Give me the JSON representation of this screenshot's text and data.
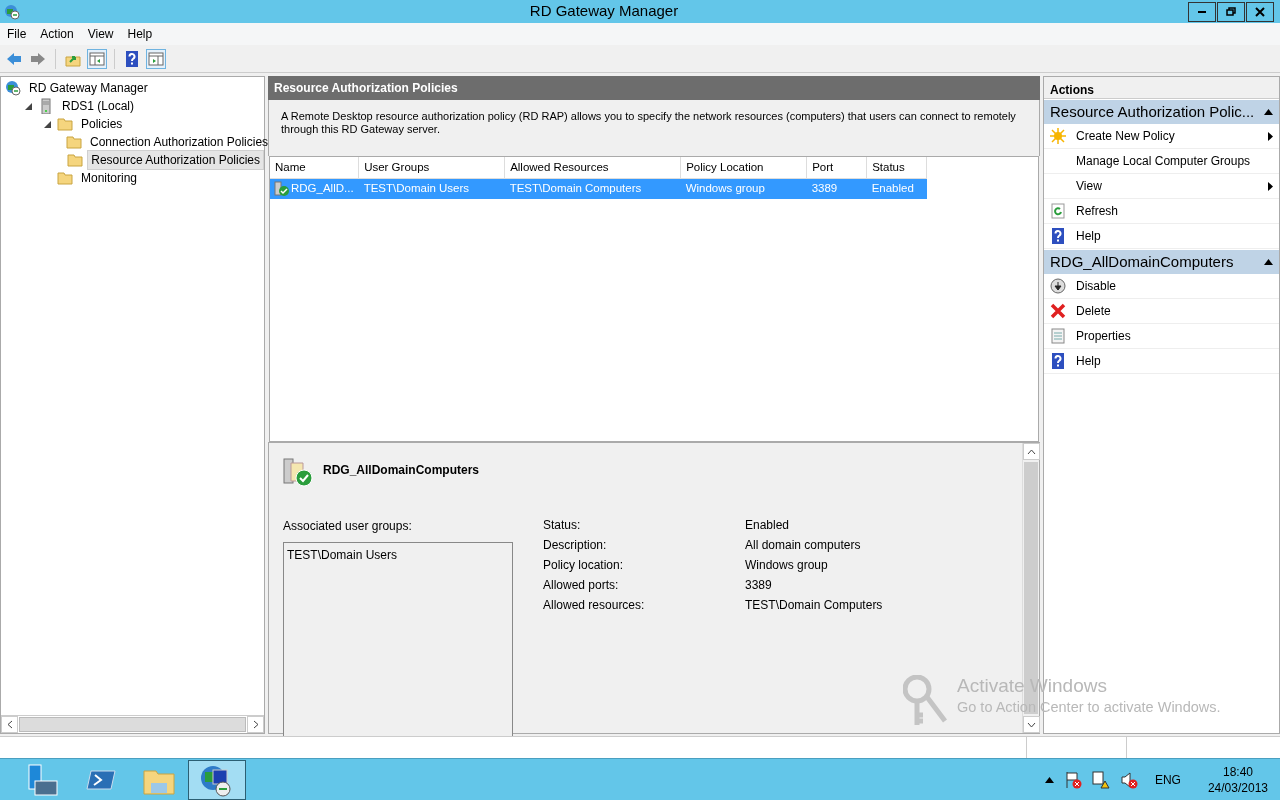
{
  "window": {
    "title": "RD Gateway Manager"
  },
  "menu": [
    "File",
    "Action",
    "View",
    "Help"
  ],
  "tree": [
    {
      "label": "RD Gateway Manager",
      "kind": "root",
      "selected": false,
      "children": [
        {
          "label": "RDS1 (Local)",
          "kind": "server",
          "selected": false,
          "expanded": true,
          "children": [
            {
              "label": "Policies",
              "kind": "folder",
              "selected": false,
              "expanded": true,
              "children": [
                {
                  "label": "Connection Authorization Policies",
                  "kind": "folder",
                  "selected": false
                },
                {
                  "label": "Resource Authorization Policies",
                  "kind": "folder",
                  "selected": true
                }
              ]
            },
            {
              "label": "Monitoring",
              "kind": "folder",
              "selected": false
            }
          ]
        }
      ]
    }
  ],
  "pane_title": "Resource Authorization Policies",
  "description": "A Remote Desktop resource authorization policy (RD RAP) allows you to specify the network resources (computers) that users can connect to remotely through this RD Gateway server.",
  "table": {
    "columns": [
      "Name",
      "User Groups",
      "Allowed Resources",
      "Policy Location",
      "Port",
      "Status"
    ],
    "rows": [
      {
        "cells": [
          "RDG_AllD...",
          "TEST\\Domain Users",
          "TEST\\Domain Computers",
          "Windows group",
          "3389",
          "Enabled"
        ],
        "selected": true
      }
    ]
  },
  "details": {
    "name": "RDG_AllDomainComputers",
    "groups_label": "Associated user groups:",
    "groups": [
      "TEST\\Domain Users"
    ],
    "properties": [
      {
        "label": "Status:",
        "value": "Enabled"
      },
      {
        "label": "Description:",
        "value": "All domain computers"
      },
      {
        "label": "Policy location:",
        "value": "Windows group"
      },
      {
        "label": "Allowed ports:",
        "value": "3389"
      },
      {
        "label": "Allowed resources:",
        "value": "TEST\\Domain Computers"
      }
    ]
  },
  "actions": {
    "title": "Actions",
    "sections": [
      {
        "title": "Resource Authorization Polic...",
        "expanded": true,
        "items": [
          {
            "label": "Create New Policy",
            "kind": "create",
            "submenu": true
          },
          {
            "label": "Manage Local Computer Groups",
            "kind": "plain"
          },
          {
            "label": "View",
            "kind": "plain",
            "submenu": true
          },
          {
            "label": "Refresh",
            "kind": "refresh"
          },
          {
            "label": "Help",
            "kind": "help"
          }
        ]
      },
      {
        "title": "RDG_AllDomainComputers",
        "expanded": true,
        "items": [
          {
            "label": "Disable",
            "kind": "disable"
          },
          {
            "label": "Delete",
            "kind": "delete"
          },
          {
            "label": "Properties",
            "kind": "properties"
          },
          {
            "label": "Help",
            "kind": "help"
          }
        ]
      }
    ]
  },
  "activation": {
    "title": "Activate Windows",
    "subtitle": "Go to Action Center to activate Windows."
  },
  "taskbar": {
    "apps": [
      {
        "kind": "server-manager",
        "selected": false
      },
      {
        "kind": "powershell",
        "selected": false
      },
      {
        "kind": "explorer",
        "selected": false
      },
      {
        "kind": "gateway",
        "selected": true
      }
    ],
    "language": "ENG",
    "time": "18:40",
    "date": "24/03/2013"
  }
}
